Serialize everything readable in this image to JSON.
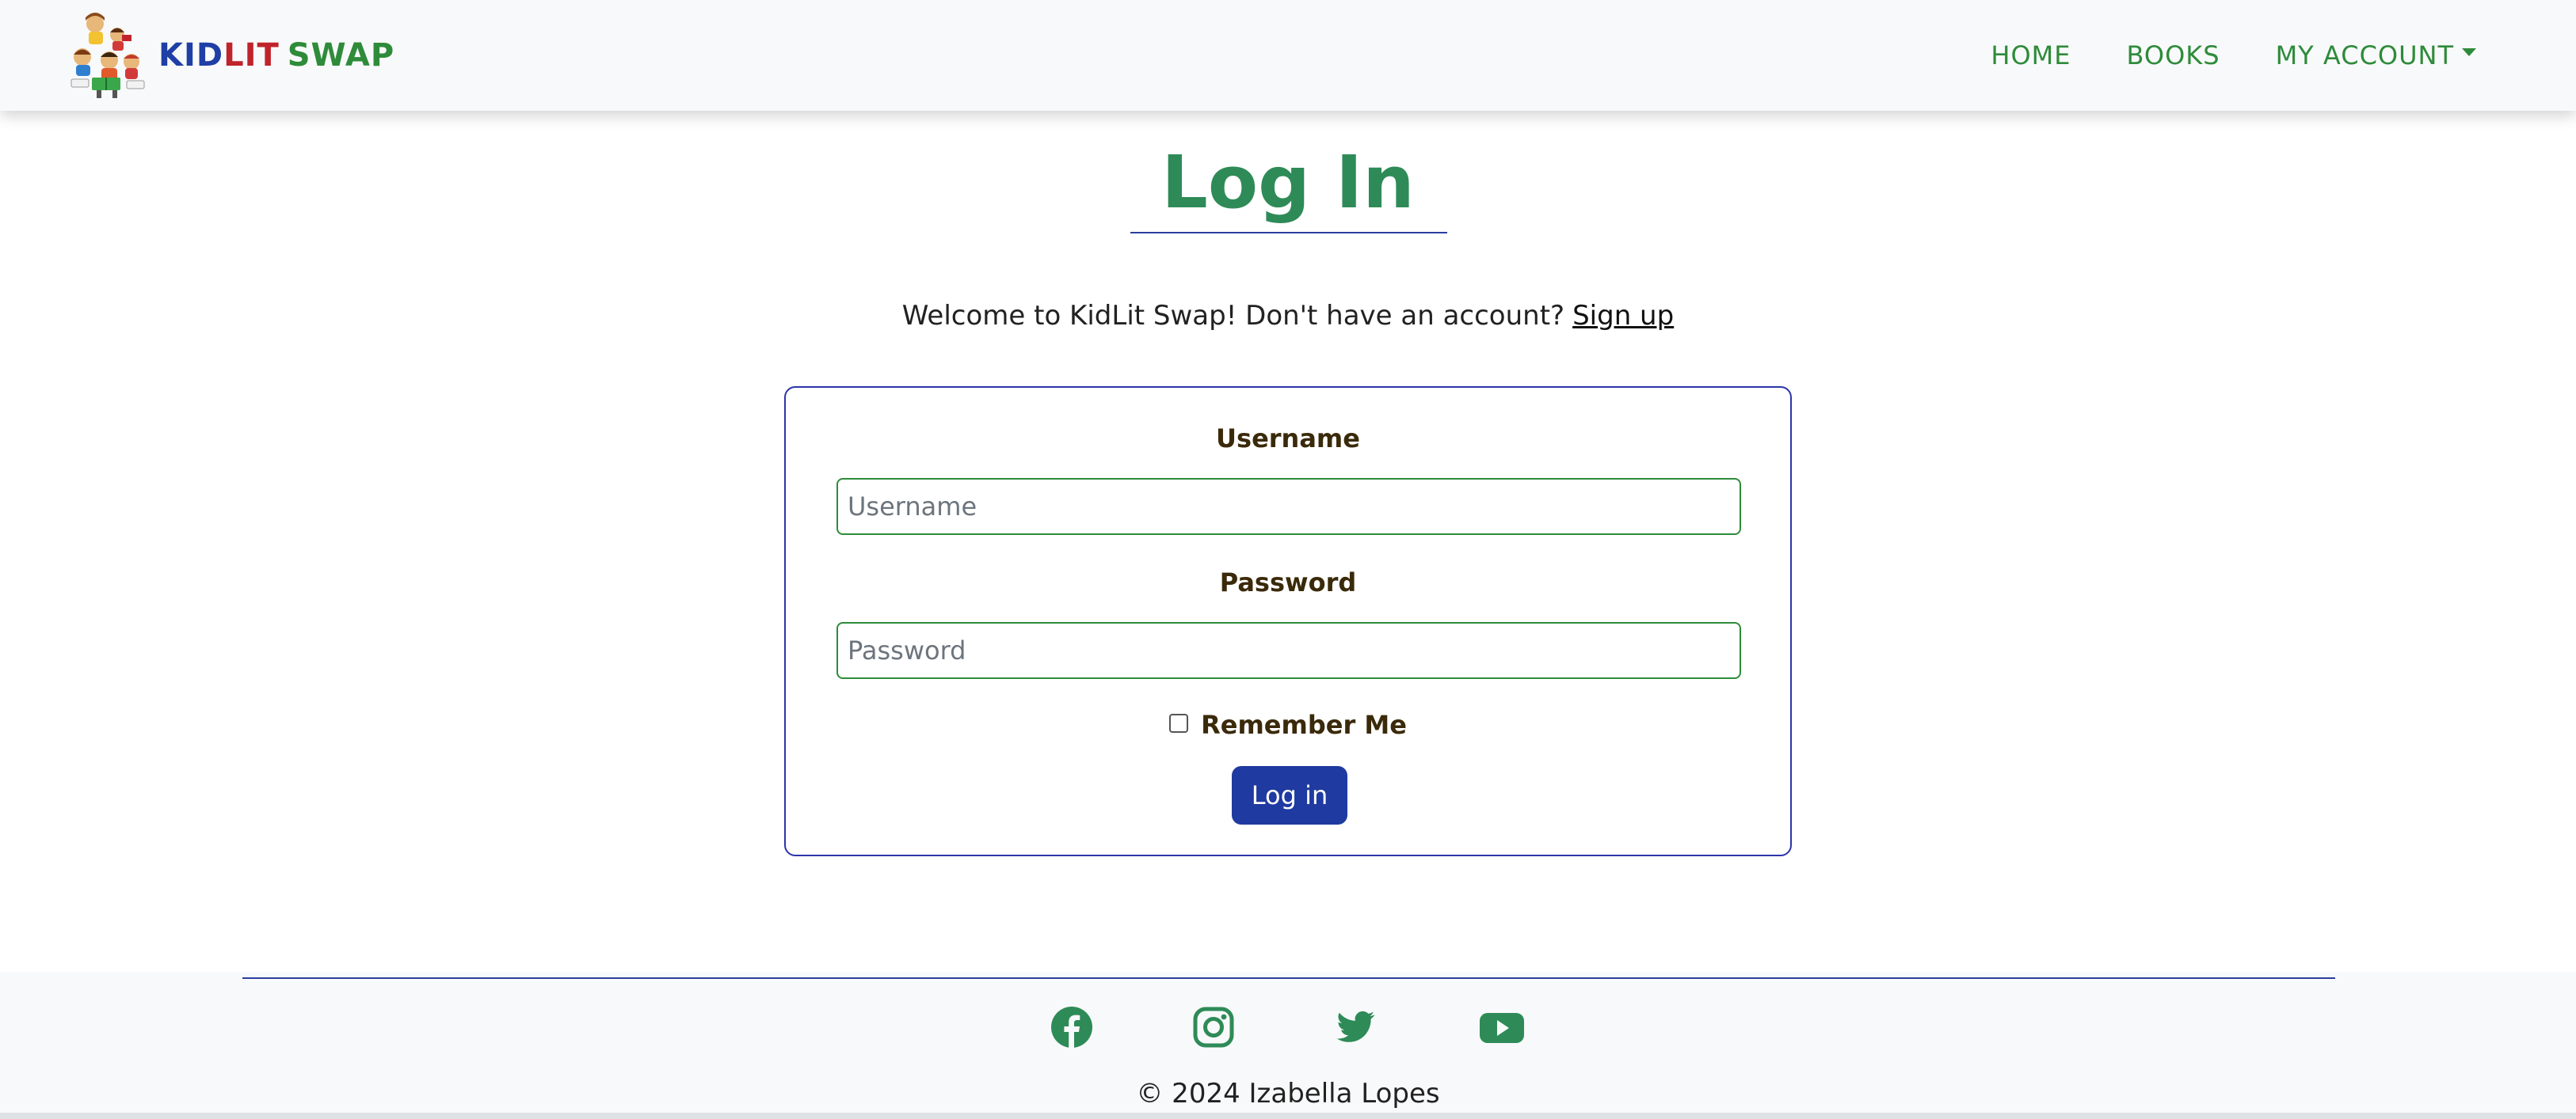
{
  "navbar": {
    "brand": {
      "kid": "KID",
      "lit": "LIT",
      "swap": "SWAP",
      "logo_icon": "children-reading-books-logo"
    },
    "links": {
      "home": "HOME",
      "books": "BOOKS",
      "account": "MY ACCOUNT"
    }
  },
  "main": {
    "title": "Log In",
    "welcome_text": "Welcome to KidLit Swap! Don't have an account?",
    "signup_link": "Sign up",
    "form": {
      "username_label": "Username",
      "username_placeholder": "Username",
      "username_value": "",
      "password_label": "Password",
      "password_placeholder": "Password",
      "password_value": "",
      "remember_label": "Remember Me",
      "remember_checked": false,
      "submit_label": "Log in"
    }
  },
  "footer": {
    "social_icons": [
      "facebook-icon",
      "instagram-icon",
      "twitter-icon",
      "youtube-icon"
    ],
    "copyright": "© 2024 Izabella Lopes"
  },
  "colors": {
    "brand_green": "#2e8b57",
    "accent_blue": "#1f3aa0",
    "navbar_bg": "#f8f9fa"
  }
}
